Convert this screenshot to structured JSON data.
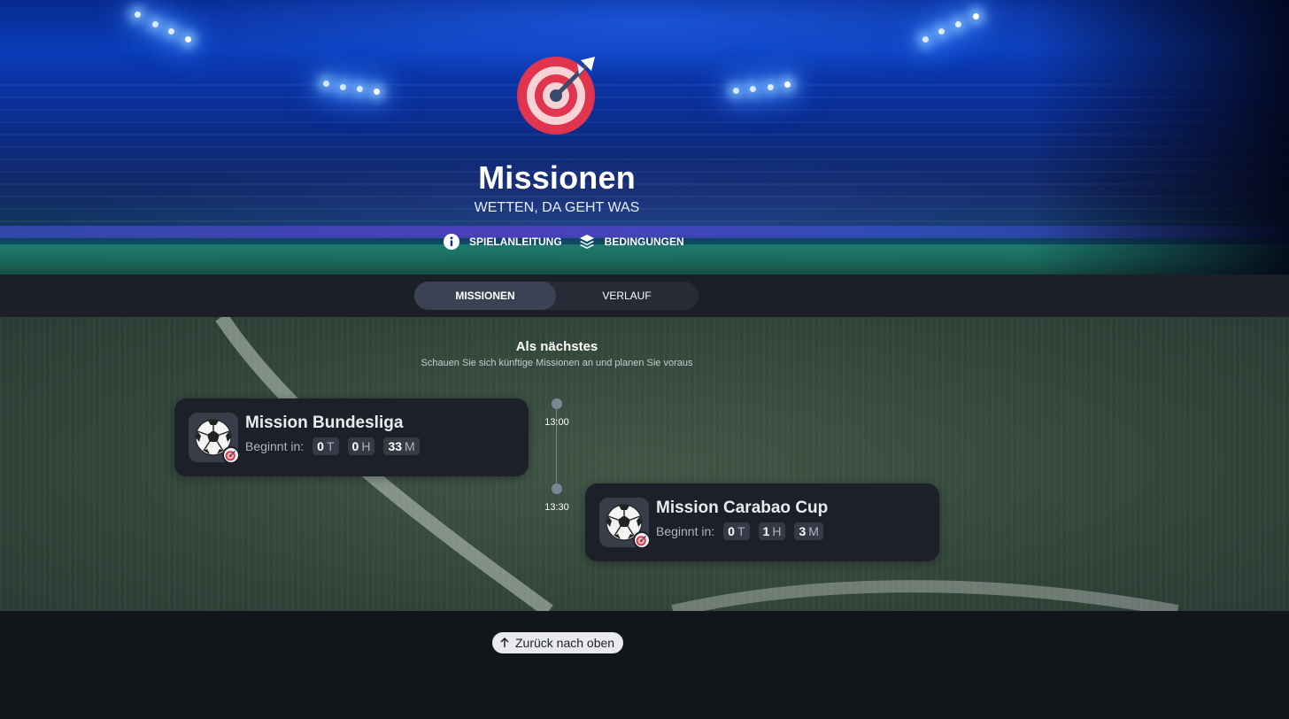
{
  "hero": {
    "title": "Missionen",
    "subtitle": "WETTEN, DA GEHT WAS",
    "links": [
      {
        "label": "SPIELANLEITUNG",
        "icon": "info-icon"
      },
      {
        "label": "BEDINGUNGEN",
        "icon": "layers-icon"
      }
    ],
    "logo_icon": "target-dart-icon"
  },
  "tabs": [
    {
      "label": "MISSIONEN",
      "active": true
    },
    {
      "label": "VERLAUF",
      "active": false
    }
  ],
  "upcoming": {
    "title": "Als nächstes",
    "subtitle": "Schauen Sie sich künftige Missionen an und planen Sie voraus"
  },
  "timeline": [
    {
      "time": "13:00",
      "mission": {
        "title": "Mission Bundesliga",
        "starts_label": "Beginnt in:",
        "days": "0",
        "days_unit": "T",
        "hours": "0",
        "hours_unit": "H",
        "minutes": "33",
        "minutes_unit": "M",
        "icon": "soccer-ball-icon"
      }
    },
    {
      "time": "13:30",
      "mission": {
        "title": "Mission Carabao Cup",
        "starts_label": "Beginnt in:",
        "days": "0",
        "days_unit": "T",
        "hours": "1",
        "hours_unit": "H",
        "minutes": "3",
        "minutes_unit": "M",
        "icon": "soccer-ball-icon"
      }
    }
  ],
  "footer": {
    "back_to_top": "Zurück nach oben"
  },
  "colors": {
    "accent_red": "#e0344f",
    "card_bg": "#1d2028",
    "tabbar_bg": "#1c1f27"
  }
}
